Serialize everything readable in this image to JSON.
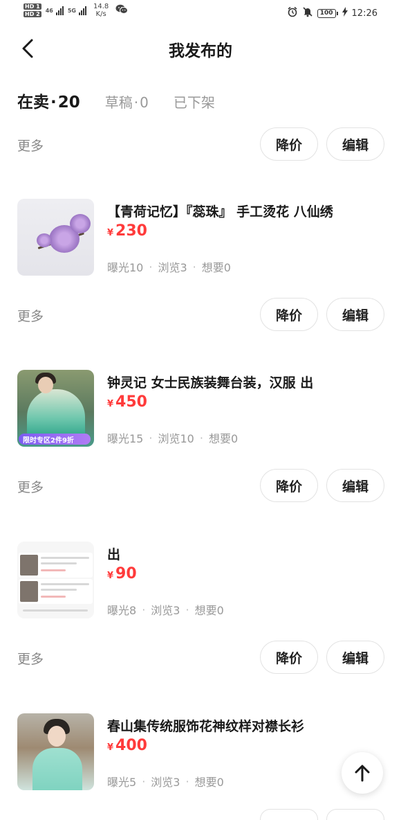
{
  "status_bar": {
    "hd1": "HD 1",
    "hd2": "HD 2",
    "net1": "46",
    "net2": "5G",
    "speed_value": "14.8",
    "speed_unit": "K/s",
    "battery": "100",
    "time": "12:26",
    "icons": [
      "hd-icon",
      "signal-icon",
      "wechat-icon",
      "alarm-icon",
      "mute-icon",
      "battery-icon",
      "charging-icon"
    ]
  },
  "nav": {
    "title": "我发布的",
    "back_icon": "chevron-left-icon"
  },
  "tabs": [
    {
      "label": "在卖",
      "count": "20"
    },
    {
      "label": "草稿",
      "count": "0"
    },
    {
      "label": "已下架"
    }
  ],
  "actions": {
    "more": "更多",
    "price_cut": "降价",
    "edit": "编辑"
  },
  "items": [
    {
      "title": "【青荷记忆】『蕊珠』 手工烫花 八仙绣",
      "currency": "¥",
      "price": "230",
      "exposure": "曝光10",
      "views": "浏览3",
      "wants": "想要0"
    },
    {
      "title": "钟灵记 女士民族装舞台装，汉服 出",
      "currency": "¥",
      "price": "450",
      "exposure": "曝光15",
      "views": "浏览10",
      "wants": "想要0",
      "promo": "限时专区2件9折"
    },
    {
      "title": "出",
      "currency": "¥",
      "price": "90",
      "exposure": "曝光8",
      "views": "浏览3",
      "wants": "想要0"
    },
    {
      "title": "春山集传统服饰花神纹样对襟长衫",
      "currency": "¥",
      "price": "400",
      "exposure": "曝光5",
      "views": "浏览3",
      "wants": "想要0"
    }
  ],
  "colors": {
    "price_red": "#ff3b3b",
    "muted_text": "#999999",
    "title_text": "#1a1a1a"
  },
  "scroll_top_icon": "arrow-up-icon"
}
